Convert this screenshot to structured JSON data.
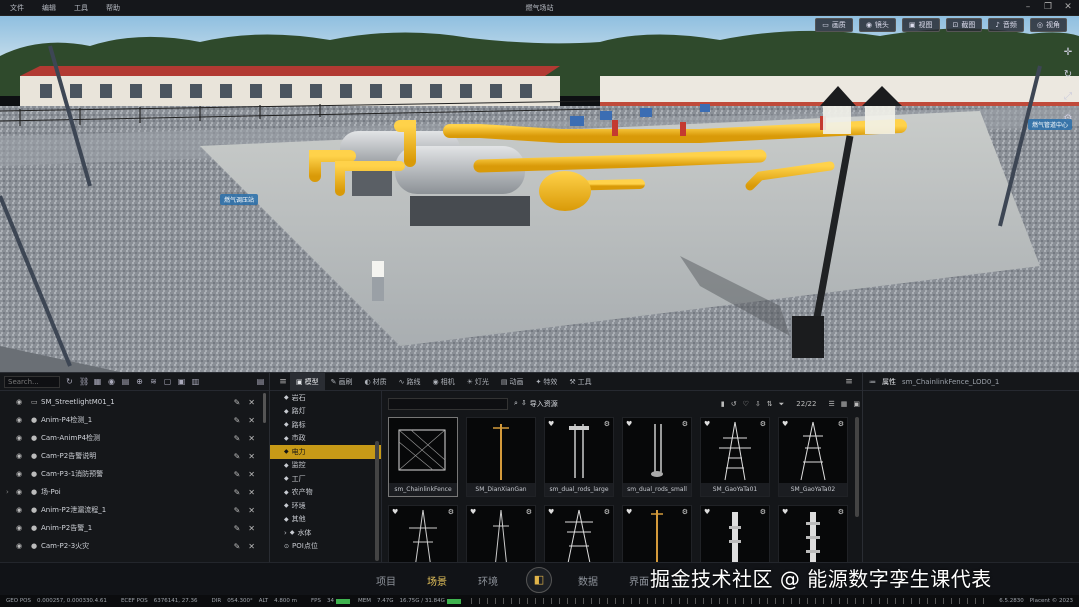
{
  "menubar": {
    "menus": [
      "文件",
      "编辑",
      "工具",
      "帮助"
    ],
    "title": "燃气场站"
  },
  "viewport": {
    "tools": [
      {
        "label": "画质",
        "icon": "monitor-icon"
      },
      {
        "label": "镜头",
        "icon": "camera-icon"
      },
      {
        "label": "视图",
        "icon": "view-icon"
      },
      {
        "label": "截图",
        "icon": "screenshot-icon"
      },
      {
        "label": "音频",
        "icon": "audio-icon"
      },
      {
        "label": "视角",
        "icon": "eye-icon"
      }
    ],
    "labels": {
      "left_tag": "燃气调压站",
      "right_tag": "燃气管道中心"
    }
  },
  "outliner": {
    "search_placeholder": "Search...",
    "items": [
      {
        "label": "SM_StreetlightM01_1",
        "type": "▭",
        "arrow": ""
      },
      {
        "label": "Anim-P4检测_1",
        "type": "●",
        "arrow": ""
      },
      {
        "label": "Cam-AnimP4检测",
        "type": "●",
        "arrow": ""
      },
      {
        "label": "Cam-P2告警说明",
        "type": "●",
        "arrow": ""
      },
      {
        "label": "Cam-P3-1消防预警",
        "type": "●",
        "arrow": ""
      },
      {
        "label": "场-Poi",
        "type": "●",
        "arrow": "›"
      },
      {
        "label": "Anim-P2泄漏流程_1",
        "type": "●",
        "arrow": ""
      },
      {
        "label": "Anim-P2告警_1",
        "type": "●",
        "arrow": ""
      },
      {
        "label": "Cam-P2-3火灾",
        "type": "●",
        "arrow": ""
      }
    ]
  },
  "assets": {
    "tabs": [
      {
        "label": "模型",
        "active": true
      },
      {
        "label": "画刷",
        "active": false
      },
      {
        "label": "材质",
        "active": false
      },
      {
        "label": "路线",
        "active": false
      },
      {
        "label": "相机",
        "active": false
      },
      {
        "label": "灯光",
        "active": false
      },
      {
        "label": "动画",
        "active": false
      },
      {
        "label": "特效",
        "active": false
      },
      {
        "label": "工具",
        "active": false
      }
    ],
    "categories": [
      {
        "label": "岩石",
        "selected": false,
        "arrow": ""
      },
      {
        "label": "路灯",
        "selected": false,
        "arrow": ""
      },
      {
        "label": "路标",
        "selected": false,
        "arrow": ""
      },
      {
        "label": "市政",
        "selected": false,
        "arrow": ""
      },
      {
        "label": "电力",
        "selected": true,
        "arrow": ""
      },
      {
        "label": "监控",
        "selected": false,
        "arrow": ""
      },
      {
        "label": "工厂",
        "selected": false,
        "arrow": ""
      },
      {
        "label": "农产物",
        "selected": false,
        "arrow": ""
      },
      {
        "label": "环境",
        "selected": false,
        "arrow": ""
      },
      {
        "label": "其他",
        "selected": false,
        "arrow": ""
      },
      {
        "label": "水体",
        "selected": false,
        "arrow": "›"
      },
      {
        "label": "POI点位",
        "selected": false,
        "arrow": ""
      }
    ],
    "import_label": "导入资源",
    "page_count": "22/22",
    "items": [
      {
        "name": "sm_ChainlinkFence",
        "kind": "fence",
        "selected": true
      },
      {
        "name": "SM_DianXianGan",
        "kind": "pole",
        "selected": false
      },
      {
        "name": "sm_dual_rods_large",
        "kind": "rods",
        "selected": false
      },
      {
        "name": "sm_dual_rods_small",
        "kind": "rods2",
        "selected": false
      },
      {
        "name": "SM_GaoYaTa01",
        "kind": "tower",
        "selected": false
      },
      {
        "name": "SM_GaoYaTa02",
        "kind": "tower2",
        "selected": false
      },
      {
        "name": "",
        "kind": "tower3",
        "selected": false
      },
      {
        "name": "",
        "kind": "tower4",
        "selected": false
      },
      {
        "name": "",
        "kind": "tower5",
        "selected": false
      },
      {
        "name": "",
        "kind": "pole2",
        "selected": false
      },
      {
        "name": "",
        "kind": "insulator",
        "selected": false
      },
      {
        "name": "",
        "kind": "insulator2",
        "selected": false
      }
    ]
  },
  "properties": {
    "title": "属性",
    "object": "sm_ChainlinkFence_LOD0_1"
  },
  "nav": {
    "items": [
      "项目",
      "场景",
      "环境",
      "数据",
      "界面"
    ],
    "active": "场景",
    "watermark": "掘金技术社区 @ 能源数字孪生课代表"
  },
  "status": {
    "geo": "GEO POS",
    "geo_val": "0.000257, 0.000330.4.61",
    "ecef": "ECEF POS",
    "ecef_val": "6376141, 27.36",
    "dir": "DIR",
    "dir_val": "054.300°",
    "alt": "ALT",
    "alt_val": "4.800 m",
    "fps": "FPS",
    "fps_val": "34",
    "mem": "MEM",
    "mem_val": "7.47G",
    "mem_total": "16.75G / 31.84G",
    "version": "6.5.2830",
    "copyright": "Placent © 2023"
  },
  "colors": {
    "accent": "#c79a17",
    "pipe": "#f2b61b",
    "sky": "#a9cfe7"
  }
}
